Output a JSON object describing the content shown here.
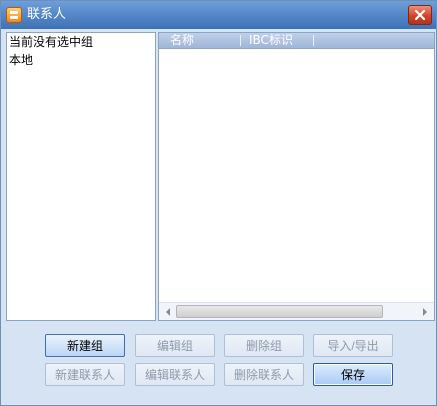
{
  "window": {
    "title": "联系人",
    "app_icon": "contacts-app-icon",
    "close_icon": "close-icon",
    "accent_title_bar": "#4f82c4",
    "close_button_color": "#d4442a"
  },
  "left_panel": {
    "items": [
      {
        "label": "当前没有选中组"
      },
      {
        "label": "本地"
      }
    ]
  },
  "contact_list": {
    "columns": [
      {
        "label": "名称"
      },
      {
        "label": "IBC标识"
      }
    ],
    "rows": []
  },
  "buttons": {
    "new_group": "新建组",
    "edit_group": "编辑组",
    "delete_group": "删除组",
    "import_export": "导入/导出",
    "new_contact": "新建联系人",
    "edit_contact": "编辑联系人",
    "delete_contact": "删除联系人",
    "save": "保存"
  }
}
